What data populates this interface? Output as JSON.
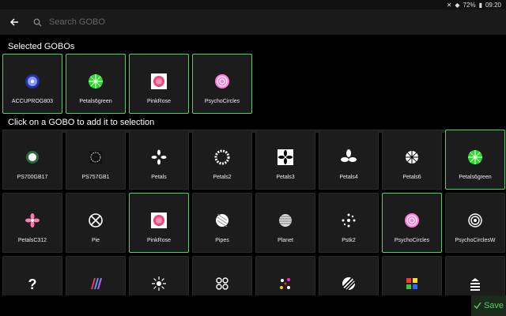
{
  "status": {
    "battery": "72%",
    "time": "09:20"
  },
  "toolbar": {
    "search_placeholder": "Search GOBO"
  },
  "selected_title": "Selected GOBOs",
  "selection_prompt": "Click on a GOBO to add it to selection",
  "selected": [
    {
      "label": "ACCUPROG803",
      "icon": "blue-mandala-icon"
    },
    {
      "label": "Petals6green",
      "icon": "green-wheel-icon"
    },
    {
      "label": "PinkRose",
      "icon": "pink-rose-icon"
    },
    {
      "label": "PsychoCircles",
      "icon": "pink-circles-icon"
    }
  ],
  "grid": [
    {
      "label": "PS700GB17",
      "icon": "glow-dot-icon",
      "selected": false
    },
    {
      "label": "PS757GB1",
      "icon": "swirl-icon",
      "selected": false
    },
    {
      "label": "Petals",
      "icon": "petals-icon",
      "selected": false
    },
    {
      "label": "Petals2",
      "icon": "petals2-icon",
      "selected": false
    },
    {
      "label": "Petals3",
      "icon": "petals3-icon",
      "selected": false
    },
    {
      "label": "Petals4",
      "icon": "petals4-icon",
      "selected": false
    },
    {
      "label": "Petals6",
      "icon": "petals6-icon",
      "selected": false
    },
    {
      "label": "Petals6green",
      "icon": "green-wheel-icon",
      "selected": true
    },
    {
      "label": "PetalsC312",
      "icon": "pink-flower-icon",
      "selected": false
    },
    {
      "label": "Pie",
      "icon": "pie-icon",
      "selected": false
    },
    {
      "label": "PinkRose",
      "icon": "pink-rose-icon",
      "selected": true
    },
    {
      "label": "Pipes",
      "icon": "pipes-icon",
      "selected": false
    },
    {
      "label": "Planet",
      "icon": "planet-icon",
      "selected": false
    },
    {
      "label": "Pstk2",
      "icon": "dots-ring-icon",
      "selected": false
    },
    {
      "label": "PsychoCircles",
      "icon": "pink-circles-icon",
      "selected": true
    },
    {
      "label": "PsychoCirclesW",
      "icon": "white-circles-icon",
      "selected": false
    },
    {
      "label": "",
      "icon": "question-icon",
      "selected": false
    },
    {
      "label": "",
      "icon": "colored-lines-icon",
      "selected": false
    },
    {
      "label": "",
      "icon": "sun-icon",
      "selected": false
    },
    {
      "label": "",
      "icon": "rings-icon",
      "selected": false
    },
    {
      "label": "",
      "icon": "multicolor-dots-icon",
      "selected": false
    },
    {
      "label": "",
      "icon": "stripe-ball-icon",
      "selected": false
    },
    {
      "label": "",
      "icon": "color-squares-icon",
      "selected": false
    },
    {
      "label": "",
      "icon": "stack-icon",
      "selected": false
    }
  ],
  "save_label": "Save",
  "colors": {
    "accent": "#4fd06a",
    "card_bg": "#1c1c1c"
  }
}
